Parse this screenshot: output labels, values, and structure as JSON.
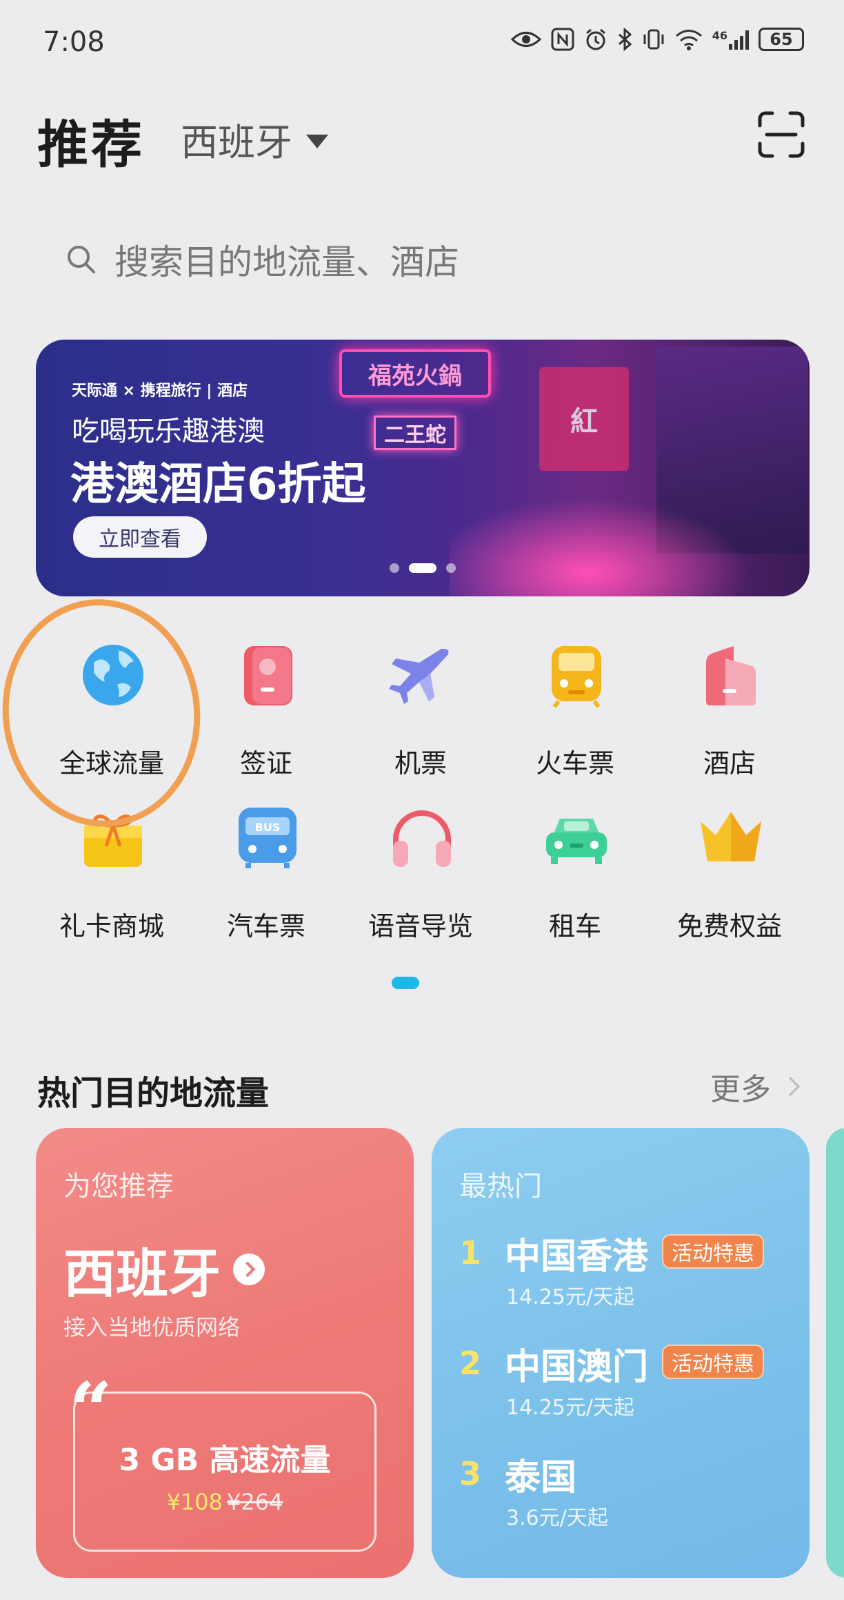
{
  "status_bar": {
    "time": "7:08",
    "network": "46",
    "battery": "65"
  },
  "header": {
    "title": "推荐",
    "region": "西班牙"
  },
  "search": {
    "placeholder": "搜索目的地流量、酒店"
  },
  "banner": {
    "brand": "天际通 × 携程旅行 | 酒店",
    "subtitle": "吃喝玩乐趣港澳",
    "headline": "港澳酒店6折起",
    "button": "立即查看",
    "signs": [
      "福苑火鍋",
      "二王蛇",
      "紅"
    ]
  },
  "services": [
    {
      "label": "全球流量",
      "icon": "globe-icon"
    },
    {
      "label": "签证",
      "icon": "passport-icon"
    },
    {
      "label": "机票",
      "icon": "airplane-icon"
    },
    {
      "label": "火车票",
      "icon": "train-icon"
    },
    {
      "label": "酒店",
      "icon": "hotel-icon"
    },
    {
      "label": "礼卡商城",
      "icon": "gift-icon"
    },
    {
      "label": "汽车票",
      "icon": "bus-icon"
    },
    {
      "label": "语音导览",
      "icon": "headphones-icon"
    },
    {
      "label": "租车",
      "icon": "car-icon"
    },
    {
      "label": "免费权益",
      "icon": "crown-icon"
    }
  ],
  "bus_icon_text": "BUS",
  "section": {
    "title": "热门目的地流量",
    "more": "更多"
  },
  "recommend_card": {
    "kicker": "为您推荐",
    "destination": "西班牙",
    "description": "接入当地优质网络",
    "package_name": "3 GB 高速流量",
    "price_now": "¥108",
    "price_was": "¥264"
  },
  "hot_card": {
    "kicker": "最热门",
    "items": [
      {
        "rank": "1",
        "name": "中国香港",
        "tag": "活动特惠",
        "price": "14.25元/天起"
      },
      {
        "rank": "2",
        "name": "中国澳门",
        "tag": "活动特惠",
        "price": "14.25元/天起"
      },
      {
        "rank": "3",
        "name": "泰国",
        "tag": "",
        "price": "3.6元/天起"
      }
    ]
  },
  "colors": {
    "accent": "#1fb6e8",
    "red_card": "#ee7a77",
    "blue_card": "#7bc0ea",
    "annotation": "#f0a050"
  }
}
